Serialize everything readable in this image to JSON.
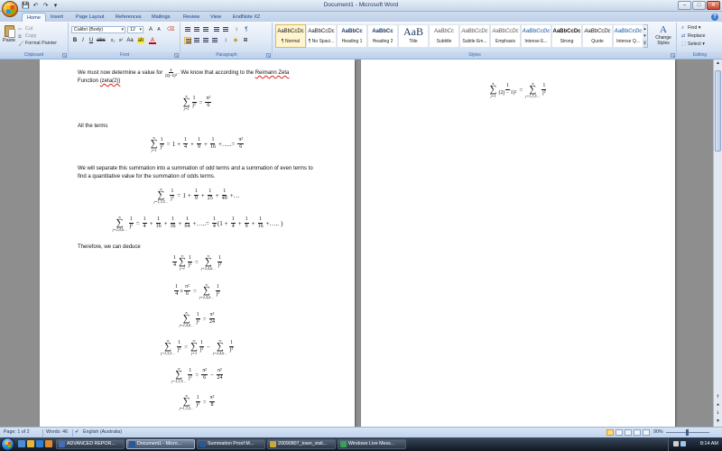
{
  "window": {
    "title": "Document1 - Microsoft Word"
  },
  "qat": [
    "💾",
    "↶",
    "↷",
    "▾"
  ],
  "window_controls": {
    "minimize": "–",
    "maximize": "□",
    "close": "✕"
  },
  "tabs": [
    "Home",
    "Insert",
    "Page Layout",
    "References",
    "Mailings",
    "Review",
    "View",
    "EndNote X2"
  ],
  "help": "?",
  "clipboard": {
    "paste": "Paste",
    "cut": "Cut",
    "copy": "Copy",
    "format_painter": "Format Painter",
    "label": "Clipboard"
  },
  "font": {
    "name": "Calibri (Body)",
    "size": "12",
    "label": "Font"
  },
  "paragraph": {
    "label": "Paragraph"
  },
  "styles": {
    "label": "Styles",
    "items": [
      {
        "sample": "AaBbCcDc",
        "name": "¶ Normal",
        "selected": true
      },
      {
        "sample": "AaBbCcDc",
        "name": "¶ No Spaci...",
        "selected": false
      },
      {
        "sample": "AaBbCc",
        "name": "Heading 1",
        "selected": false
      },
      {
        "sample": "AaBbCc",
        "name": "Heading 2",
        "selected": false
      },
      {
        "sample": "AaB",
        "name": "Title",
        "selected": false
      },
      {
        "sample": "AaBbCc",
        "name": "Subtitle",
        "selected": false
      },
      {
        "sample": "AaBbCcDc",
        "name": "Subtle Em...",
        "selected": false
      },
      {
        "sample": "AaBbCcDc",
        "name": "Emphasis",
        "selected": false
      },
      {
        "sample": "AaBbCcDc",
        "name": "Intense E...",
        "selected": false
      },
      {
        "sample": "AaBbCcDc",
        "name": "Strong",
        "selected": false
      },
      {
        "sample": "AaBbCcDc",
        "name": "Quote",
        "selected": false
      },
      {
        "sample": "AaBbCcDc",
        "name": "Intense Q...",
        "selected": false
      }
    ],
    "change_styles": "Change Styles"
  },
  "editing": {
    "find": "Find",
    "replace": "Replace",
    "select": "Select",
    "label": "Editing"
  },
  "document": {
    "intro_1": "We must now determine a value for",
    "intro_2": ". We know that according to the",
    "riemann": "Reimann Zeta",
    "function_label": "Function",
    "zeta": "(zeta(2))",
    "all_terms": "All the terms",
    "separate": "We will separate this summation into a summation of odd terms and a summation of even terms to find a quantitative value for the summation of odds terms.",
    "deduce": "Therefore, we can deduce"
  },
  "status": {
    "page": "Page: 1 of 2",
    "words": "Words: 46",
    "language": "English (Australia)",
    "zoom": "90%"
  },
  "taskbar": {
    "items": [
      {
        "label": "ADVANCED REPOR...",
        "active": false,
        "color": "#3e6fb8"
      },
      {
        "label": "Document1 - Micro...",
        "active": true,
        "color": "#2b5797"
      },
      {
        "label": "Summation Proof M...",
        "active": false,
        "color": "#2b5797"
      },
      {
        "label": "20090807_town_visit...",
        "active": false,
        "color": "#c9a93a"
      },
      {
        "label": "Windows Live Mess...",
        "active": false,
        "color": "#3aa05a"
      }
    ],
    "clock": "8:14 AM"
  }
}
